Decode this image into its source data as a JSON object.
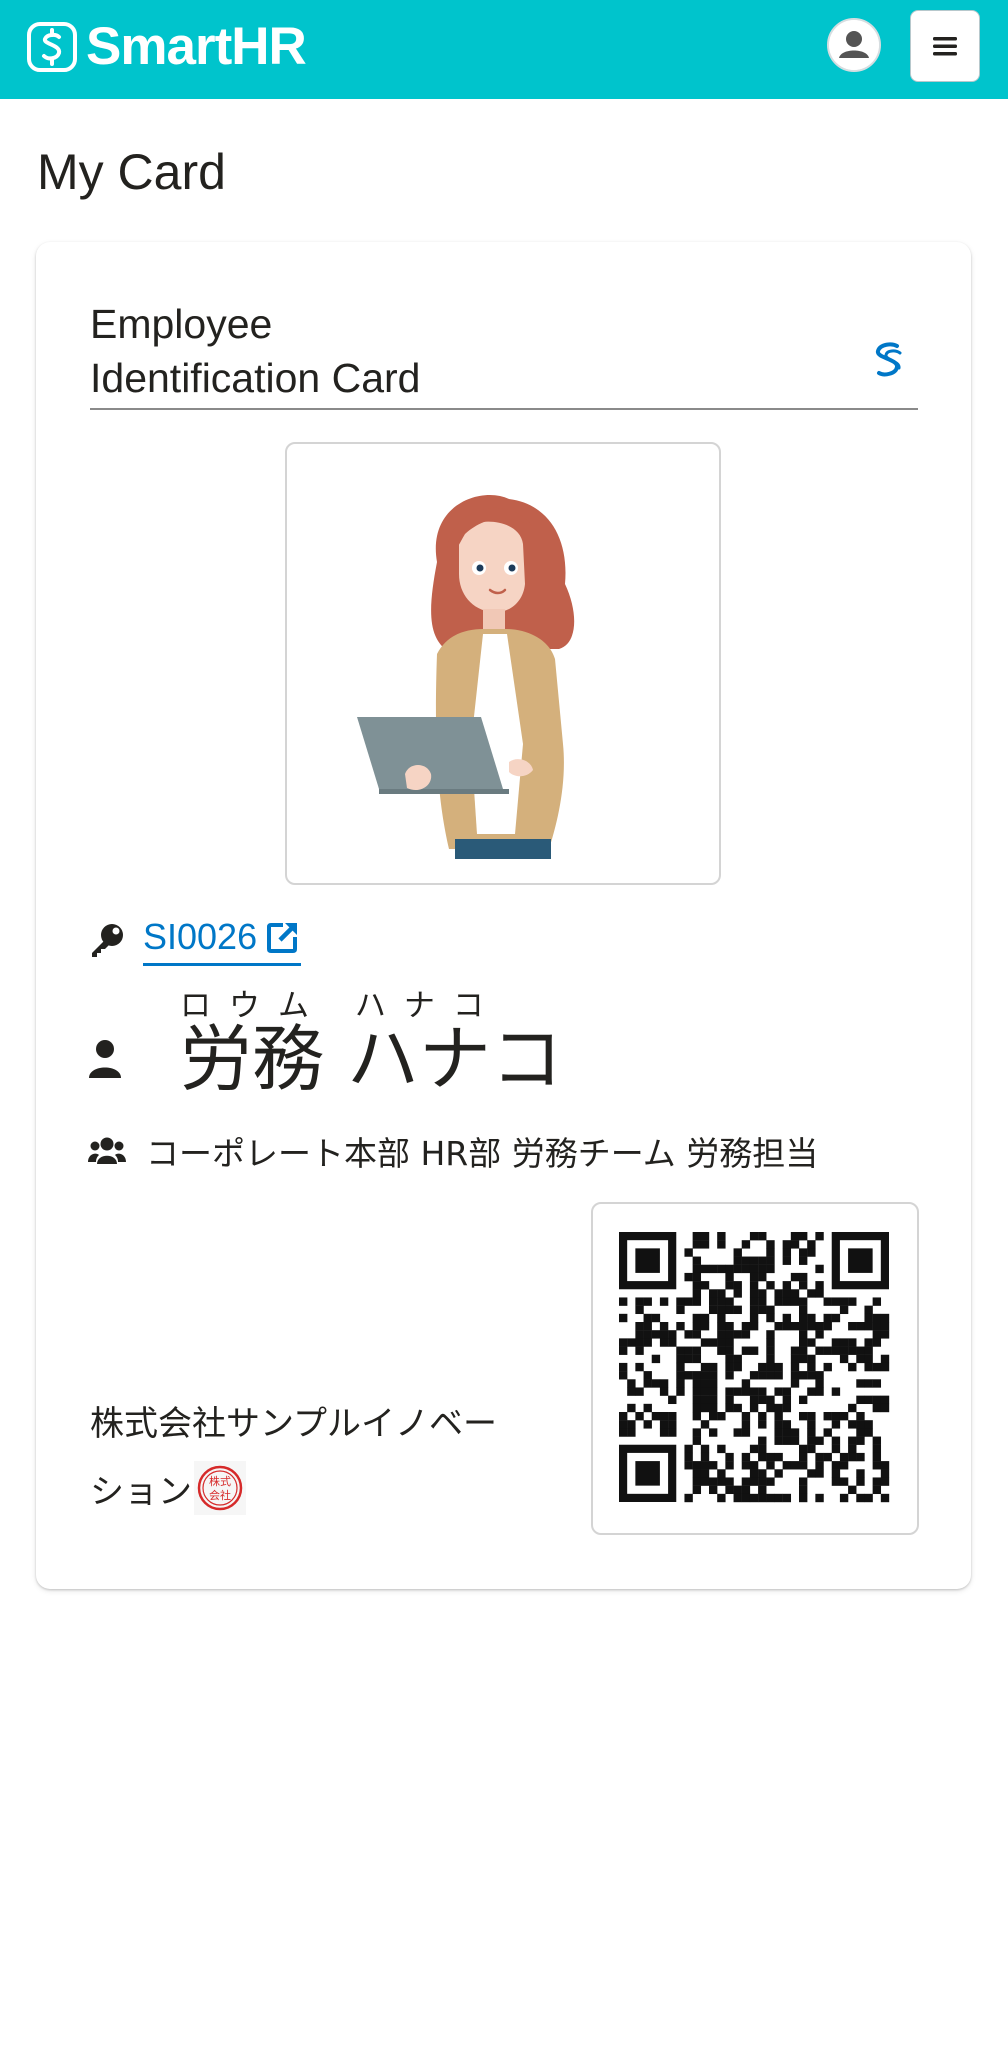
{
  "header": {
    "brand": "SmartHR",
    "colors": {
      "brand_bg": "#00c4cc",
      "link": "#0077c7"
    },
    "user_icon": "user-avatar-icon",
    "menu_icon": "hamburger-menu-icon"
  },
  "page": {
    "title": "My Card"
  },
  "card": {
    "title": "Employee\nIdentification Card",
    "employee_id": "SI0026",
    "name_kana": "ロウム ハナコ",
    "name": "労務 ハナコ",
    "department": "コーポレート本部 HR部 労務チーム 労務担当",
    "company": "株式会社サンプルイノベーション",
    "seal_text": "株式会社"
  }
}
